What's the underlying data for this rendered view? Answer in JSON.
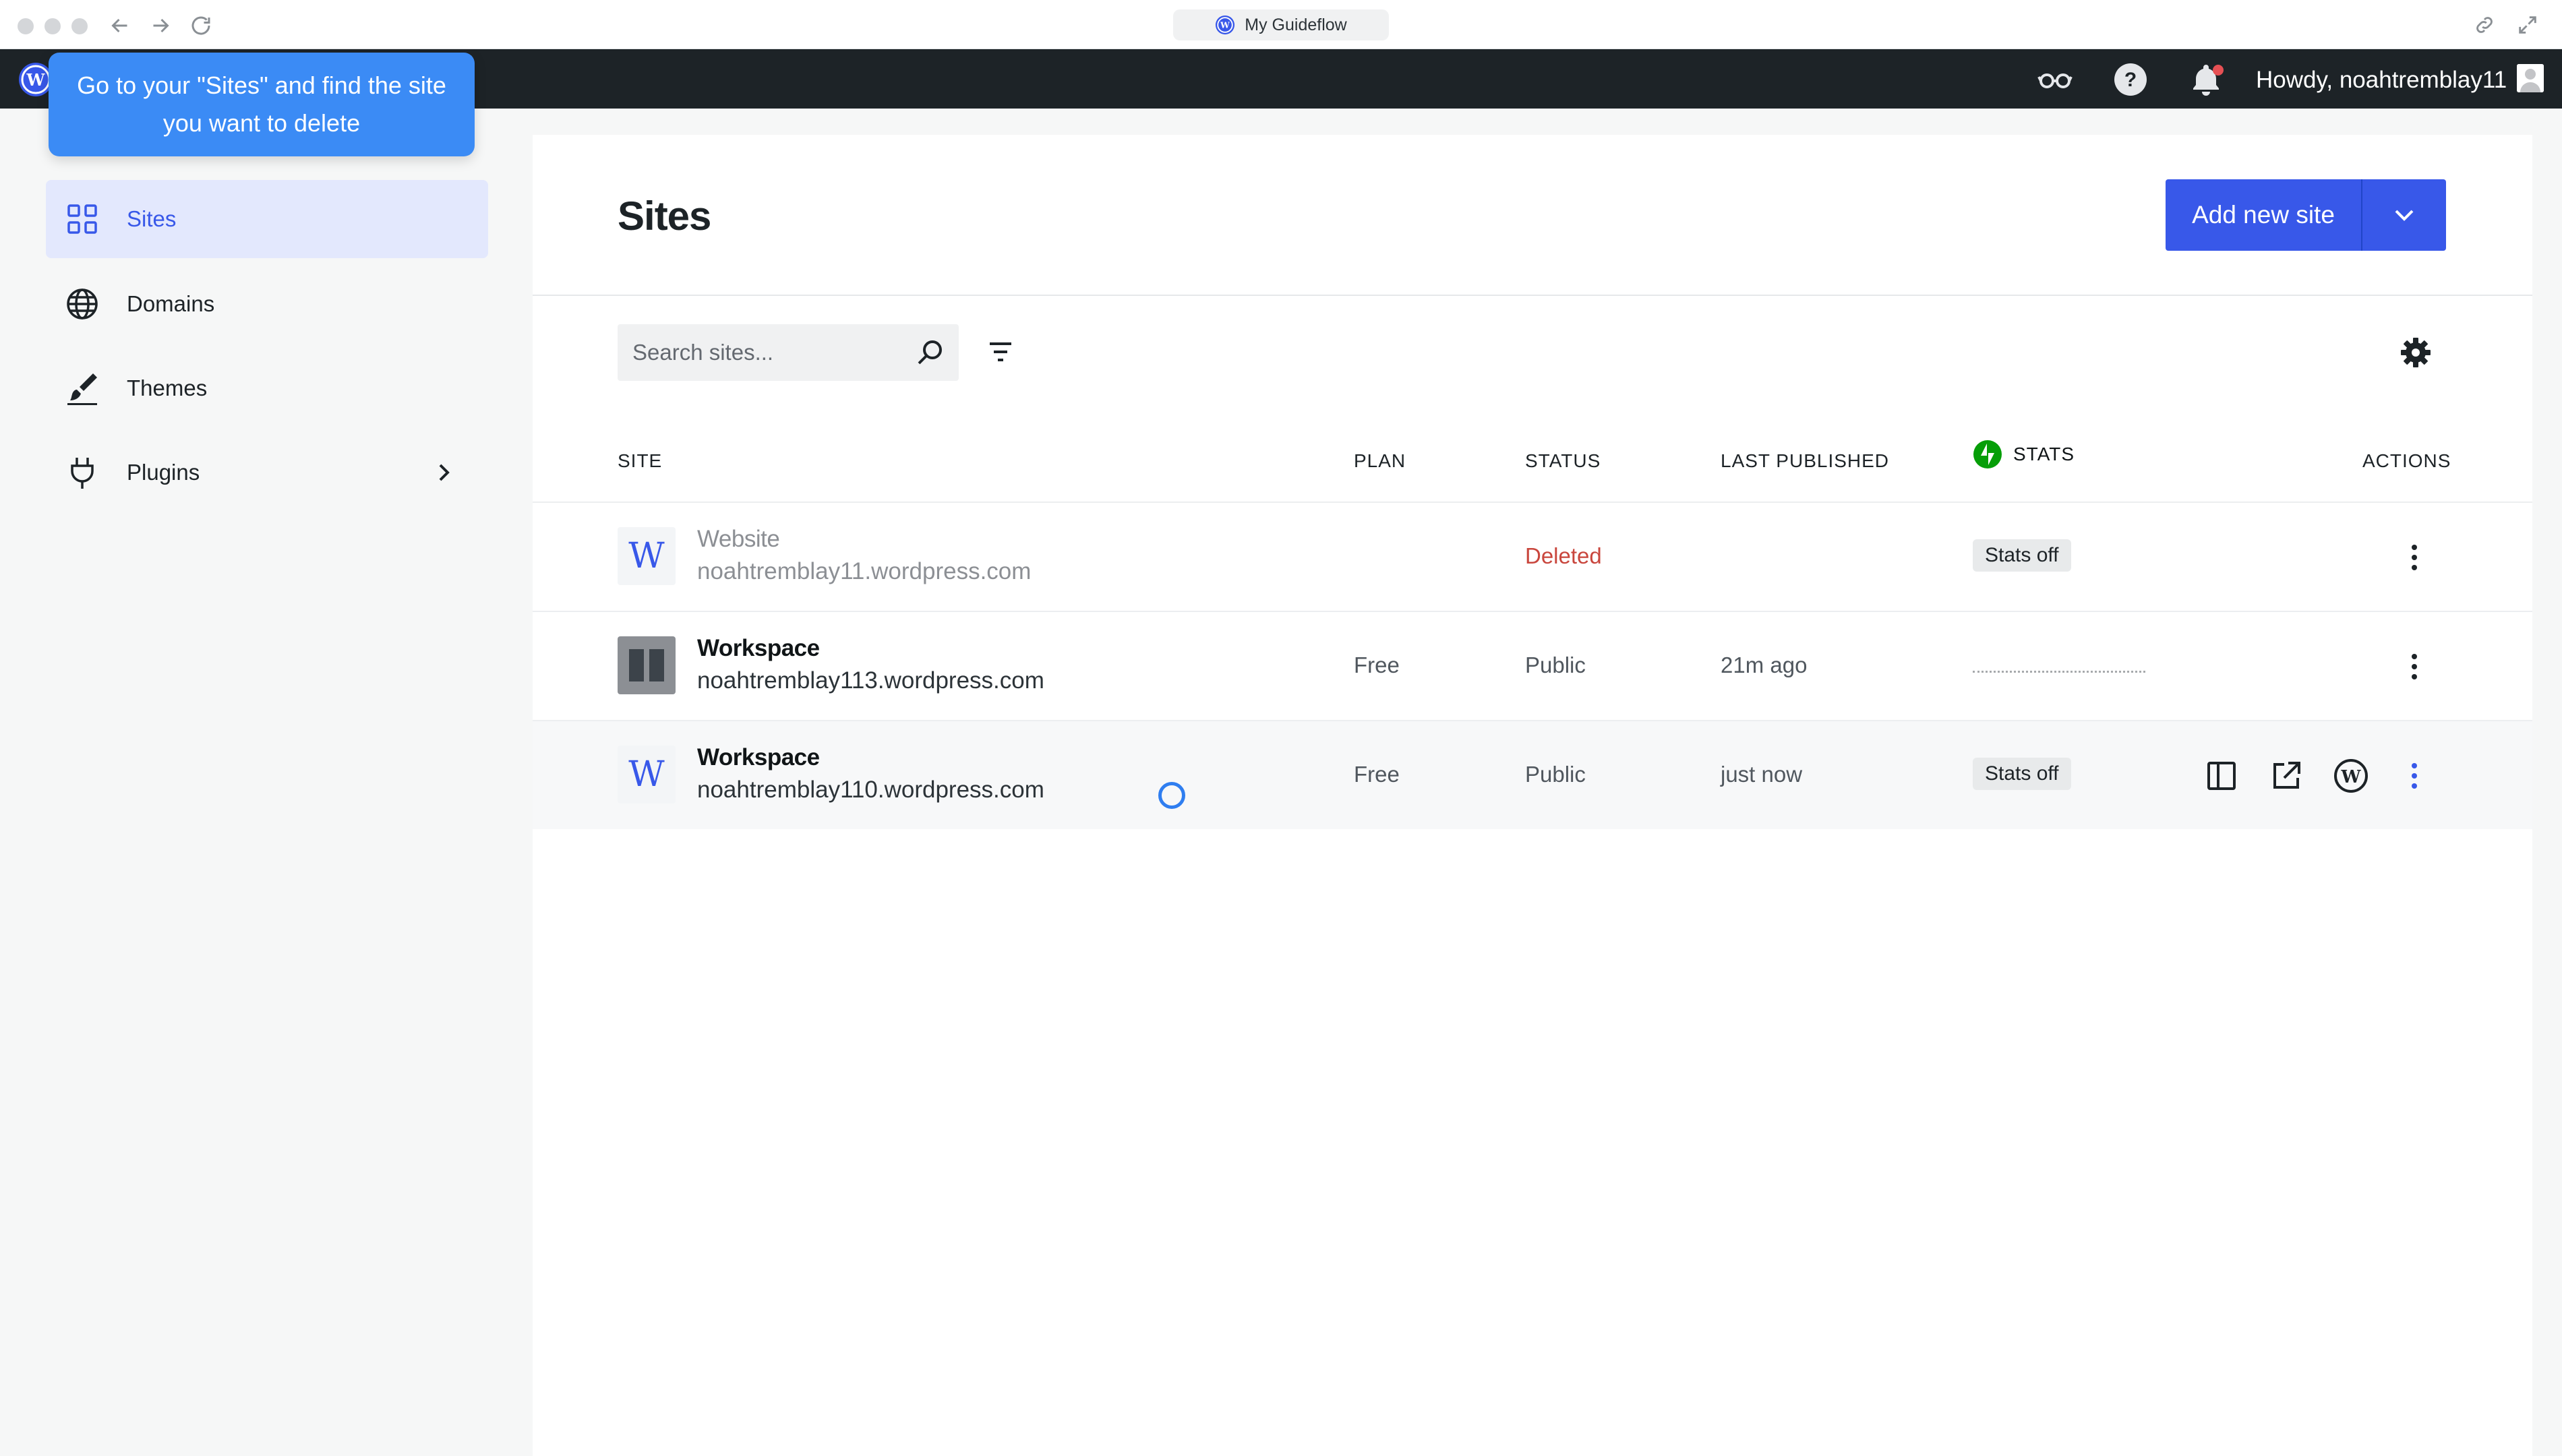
{
  "browser": {
    "tab_title": "My Guideflow"
  },
  "masterbar": {
    "howdy": "Howdy, noahtremblay11"
  },
  "tooltip": {
    "text": "Go to your \"Sites\" and find the site you want to delete"
  },
  "sidebar": {
    "items": [
      {
        "label": "Sites",
        "icon": "grid-icon",
        "active": true
      },
      {
        "label": "Domains",
        "icon": "globe-icon",
        "active": false
      },
      {
        "label": "Themes",
        "icon": "brush-icon",
        "active": false
      },
      {
        "label": "Plugins",
        "icon": "plug-icon",
        "active": false,
        "has_submenu": true
      }
    ]
  },
  "main": {
    "title": "Sites",
    "add_button": "Add new site",
    "search_placeholder": "Search sites...",
    "columns": {
      "site": "SITE",
      "plan": "PLAN",
      "status": "STATUS",
      "last_published": "LAST PUBLISHED",
      "stats": "STATS",
      "actions": "ACTIONS"
    },
    "rows": [
      {
        "name": "Website",
        "url": "noahtremblay11.wordpress.com",
        "thumb": "W",
        "plan": "",
        "status": "Deleted",
        "last_published": "",
        "stats": "Stats off"
      },
      {
        "name": "Workspace",
        "url": "noahtremblay113.wordpress.com",
        "thumb": "",
        "plan": "Free",
        "status": "Public",
        "last_published": "21m ago",
        "stats": ""
      },
      {
        "name": "Workspace",
        "url": "noahtremblay110.wordpress.com",
        "thumb": "W",
        "plan": "Free",
        "status": "Public",
        "last_published": "just now",
        "stats": "Stats off"
      }
    ]
  },
  "colors": {
    "accent": "#3858e9",
    "masterbar": "#1d2327",
    "tooltip": "#3b8bf5",
    "deleted": "#c9463d",
    "jetpack": "#069e08"
  }
}
